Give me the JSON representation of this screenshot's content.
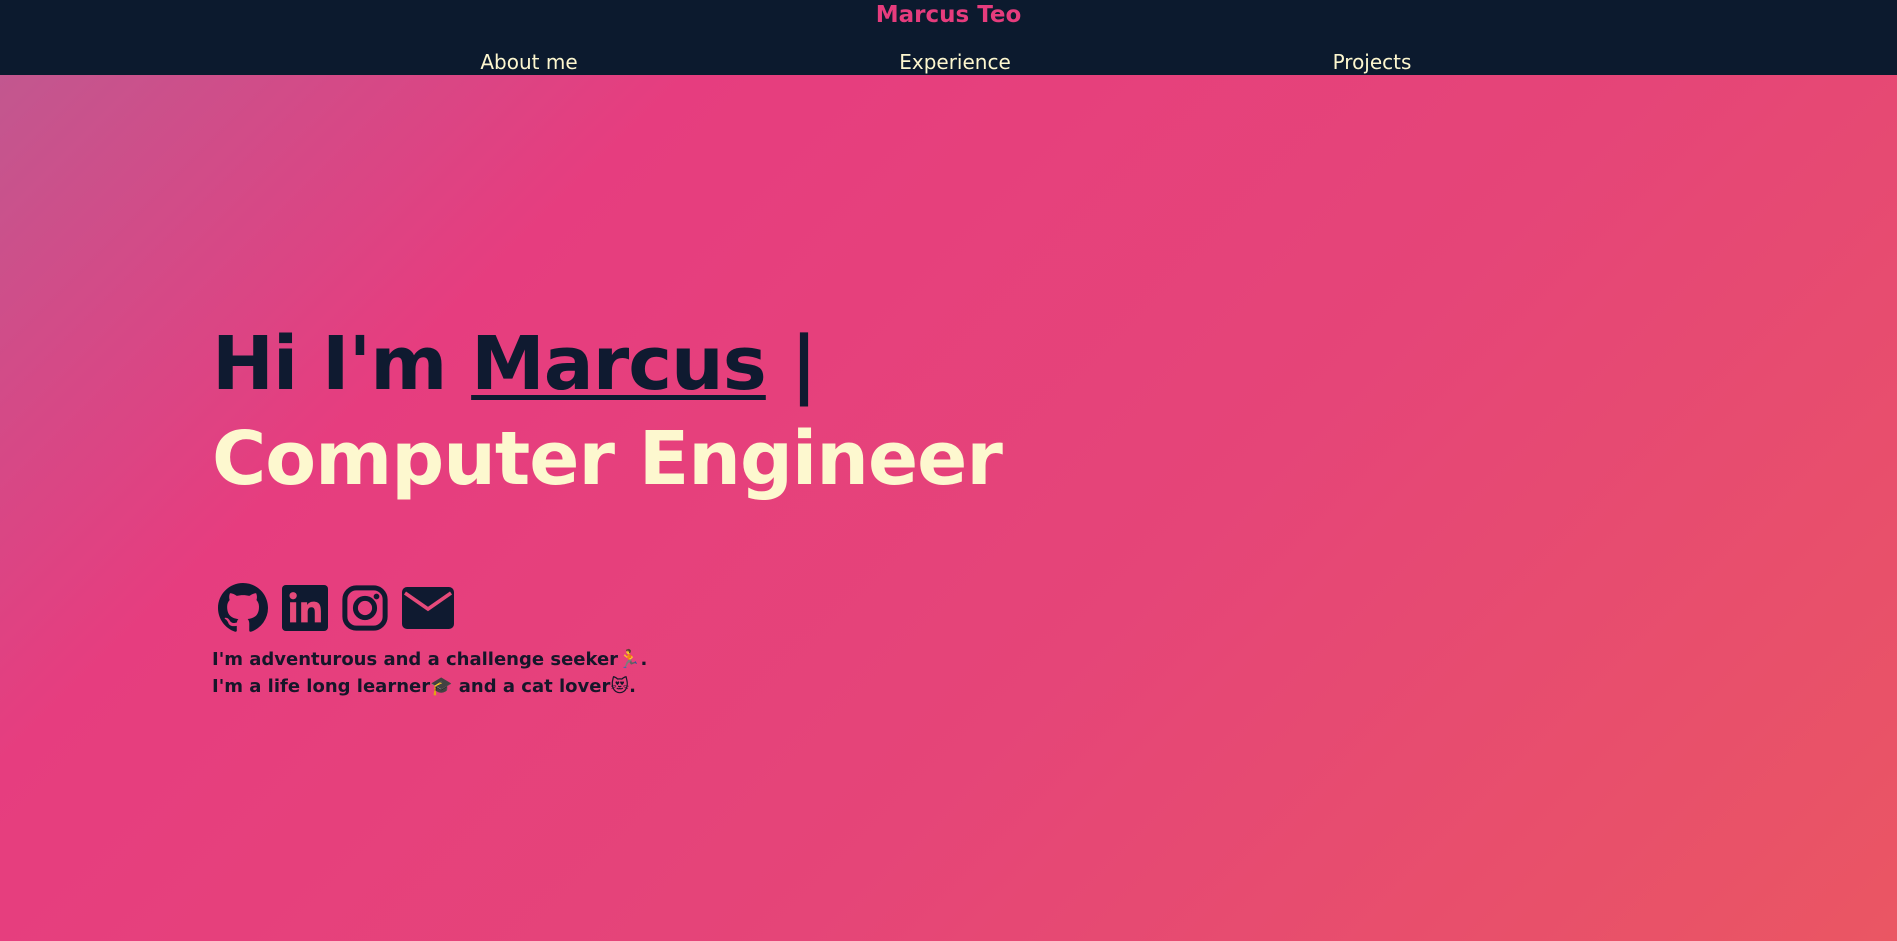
{
  "navbar": {
    "brand": "Marcus Teo",
    "links": [
      {
        "label": "About me"
      },
      {
        "label": "Experience"
      },
      {
        "label": "Projects"
      }
    ]
  },
  "hero": {
    "greeting": "Hi I'm ",
    "name": "Marcus",
    "separator": " | ",
    "role": "Computer Engineer",
    "socials": [
      {
        "icon": "github-icon"
      },
      {
        "icon": "linkedin-icon"
      },
      {
        "icon": "instagram-icon"
      },
      {
        "icon": "email-icon"
      }
    ],
    "bio_line_1": "I'm adventurous and a challenge seeker🏃.",
    "bio_line_2": "I'm a life long learner🎓 and a cat lover😻."
  },
  "colors": {
    "navbar_bg": "#0c1a2e",
    "brand": "#e63c7d",
    "nav_text": "#fdf7cf",
    "headline_dark": "#0f1a30",
    "headline_light": "#fdf8cf"
  }
}
